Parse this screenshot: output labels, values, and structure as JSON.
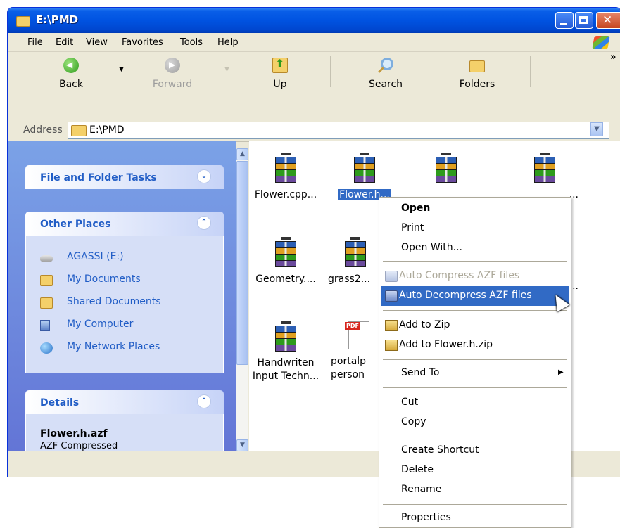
{
  "window": {
    "title": "E:\\PMD"
  },
  "menubar": {
    "items": [
      "File",
      "Edit",
      "View",
      "Favorites",
      "Tools",
      "Help"
    ]
  },
  "toolbar": {
    "back": "Back",
    "forward": "Forward",
    "up": "Up",
    "search": "Search",
    "folders": "Folders",
    "more": "»"
  },
  "address": {
    "label": "Address",
    "value": "E:\\PMD"
  },
  "taskpane": {
    "file_folder_tasks": "File and Folder Tasks",
    "other_places": {
      "title": "Other Places",
      "items": [
        "AGASSI (E:)",
        "My Documents",
        "Shared Documents",
        "My Computer",
        "My Network Places"
      ]
    },
    "details": {
      "title": "Details",
      "name": "Flower.h.azf",
      "type": "AZF Compressed"
    }
  },
  "files": [
    {
      "name": "Flower.cpp...",
      "icon": "rar-icon"
    },
    {
      "name": "Flower.h...",
      "icon": "rar-icon",
      "selected": true
    },
    {
      "name": "...",
      "icon": "rar-icon"
    },
    {
      "name": "...",
      "icon": "rar-icon"
    },
    {
      "name": "Geometry....",
      "icon": "rar-icon"
    },
    {
      "name": "grass2...",
      "icon": "rar-icon"
    },
    {
      "name": "...",
      "icon": "rar-icon"
    },
    {
      "name": "Handwriten\nInput Techn...",
      "icon": "rar-icon"
    },
    {
      "name": "portalp\nperson",
      "icon": "pdf-icon"
    }
  ],
  "context_menu": {
    "open": "Open",
    "print": "Print",
    "open_with": "Open With...",
    "auto_compress": "Auto Compress AZF files",
    "auto_decompress": "Auto Decompress AZF files",
    "add_to_zip": "Add to Zip",
    "add_to_named_zip": "Add to Flower.h.zip",
    "send_to": "Send To",
    "cut": "Cut",
    "copy": "Copy",
    "create_shortcut": "Create Shortcut",
    "delete": "Delete",
    "rename": "Rename",
    "properties": "Properties"
  },
  "colors": {
    "title_blue": "#0053e1",
    "selection": "#316ac5",
    "taskpane_link": "#215dc6"
  }
}
